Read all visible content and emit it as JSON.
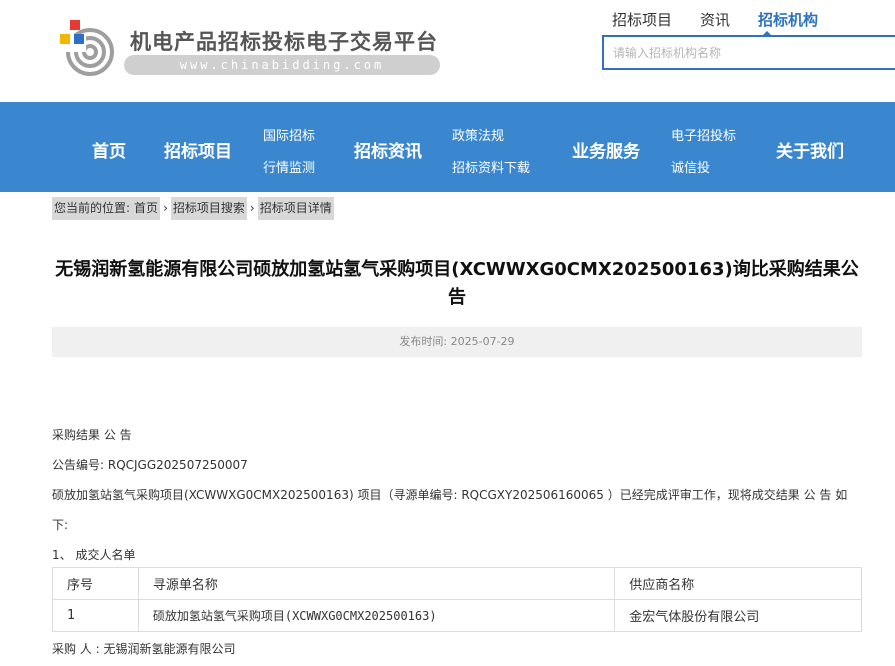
{
  "header": {
    "site_title": "机电产品招标投标电子交易平台",
    "site_url": "www.chinabidding.com",
    "logo_colors": {
      "red": "#e53935",
      "yellow": "#f2b800",
      "blue": "#2d6fc4",
      "gray": "#9e9e9e"
    },
    "tabs": [
      {
        "label": "招标项目",
        "active": false
      },
      {
        "label": "资讯",
        "active": false
      },
      {
        "label": "招标机构",
        "active": true
      }
    ],
    "search": {
      "placeholder": "请输入招标机构名称",
      "value": ""
    }
  },
  "nav": {
    "items": [
      {
        "label": "首页"
      },
      {
        "label": "招标项目"
      },
      {
        "label_top": "国际招标",
        "label_bottom": "行情监测"
      },
      {
        "label": "招标资讯"
      },
      {
        "label_top": "政策法规",
        "label_bottom": "招标资料下载"
      },
      {
        "label": "业务服务"
      },
      {
        "label_top": "电子招投标",
        "label_bottom": "诚信投"
      },
      {
        "label": "关于我们"
      }
    ],
    "background": "#3a86cf"
  },
  "breadcrumb": {
    "prefix": "您当前的位置:",
    "items": [
      "首页",
      "招标项目搜索",
      "招标项目详情"
    ],
    "separator": "›"
  },
  "article": {
    "title": "无锡润新氢能源有限公司硕放加氢站氢气采购项目(XCWWXG0CMX202500163)询比采购结果公告",
    "publish_time": "发布时间: 2025-07-29",
    "lines": {
      "heading": "采购结果 公 告",
      "notice_no": "公告编号: RQCJGG202507250007",
      "intro_1": "硕放加氢站氢气采购项目(XCWWXG0CMX202500163) 项目（寻源单编号: RQCGXY202506160065 ）已经完成评审工作，现将成交结果 公 告 如",
      "intro_2": "下:",
      "section_1": "1、 成交人名单",
      "buyer": "采购 人 : 无锡润新氢能源有限公司"
    },
    "table": {
      "headers": [
        "序号",
        "寻源单名称",
        "供应商名称"
      ],
      "rows": [
        [
          "1",
          "硕放加氢站氢气采购项目(XCWWXG0CMX202500163)",
          "金宏气体股份有限公司"
        ]
      ]
    }
  }
}
